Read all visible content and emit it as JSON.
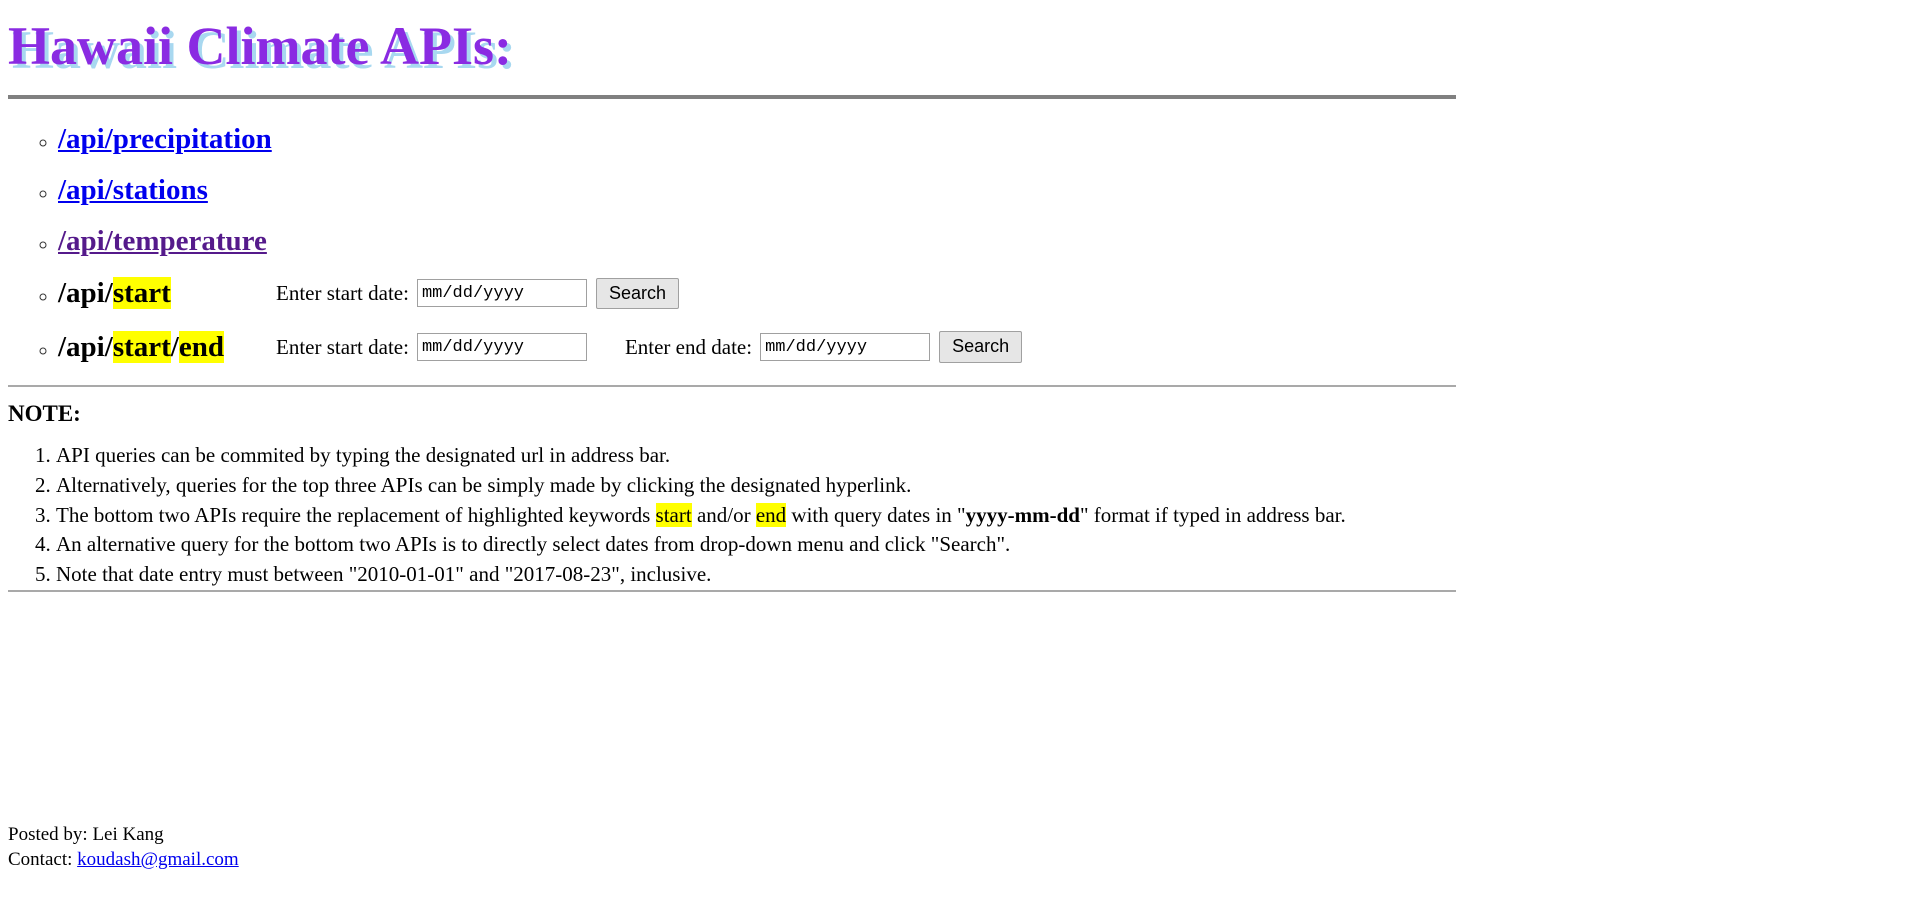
{
  "page": {
    "title": "Hawaii Climate APIs:"
  },
  "api_list": [
    {
      "kind": "link",
      "label": "/api/precipitation",
      "visited": false
    },
    {
      "kind": "link",
      "label": "/api/stations",
      "visited": false
    },
    {
      "kind": "link",
      "label": "/api/temperature",
      "visited": true
    },
    {
      "kind": "form",
      "prefix": "/api/",
      "keyword_start": "start",
      "separator": "",
      "keyword_end": "",
      "start_field": {
        "label": "Enter start date:",
        "placeholder": "mm/dd/yyyy",
        "value": ""
      },
      "search_label": "Search"
    },
    {
      "kind": "form",
      "prefix": "/api/",
      "keyword_start": "start",
      "separator": "/",
      "keyword_end": "end",
      "start_field": {
        "label": "Enter start date:",
        "placeholder": "mm/dd/yyyy",
        "value": ""
      },
      "end_field": {
        "label": "Enter end date:",
        "placeholder": "mm/dd/yyyy",
        "value": ""
      },
      "search_label": "Search"
    }
  ],
  "note": {
    "heading": "NOTE:",
    "items": [
      {
        "parts": [
          {
            "text": "API queries can be commited by typing the designated url in address bar.",
            "style": "plain"
          }
        ]
      },
      {
        "parts": [
          {
            "text": "Alternatively, queries for the top three APIs can be simply made by clicking the designated hyperlink.",
            "style": "plain"
          }
        ]
      },
      {
        "parts": [
          {
            "text": "The bottom two APIs require the replacement of highlighted keywords ",
            "style": "plain"
          },
          {
            "text": "start",
            "style": "highlight"
          },
          {
            "text": " and/or ",
            "style": "plain"
          },
          {
            "text": "end",
            "style": "highlight"
          },
          {
            "text": " with query dates in \"",
            "style": "plain"
          },
          {
            "text": "yyyy-mm-dd",
            "style": "bold"
          },
          {
            "text": "\" format if typed in address bar.",
            "style": "plain"
          }
        ]
      },
      {
        "parts": [
          {
            "text": "An alternative query for the bottom two APIs is to directly select dates from drop-down menu and click \"Search\".",
            "style": "plain"
          }
        ]
      },
      {
        "parts": [
          {
            "text": "Note that date entry must between \"2010-01-01\" and \"2017-08-23\", inclusive.",
            "style": "plain"
          }
        ]
      }
    ]
  },
  "footer": {
    "posted_by_label": "Posted by: ",
    "posted_by_name": "Lei Kang",
    "contact_label": "Contact: ",
    "contact_email": "koudash@gmail.com"
  },
  "colors": {
    "title_text": "#8a2be2",
    "title_shadow": "#a8d8f0",
    "link": "#0000ee",
    "link_visited": "#551a8b",
    "highlight": "#ffff00",
    "rule_thick": "#808080",
    "rule_thin": "#a9a9a9",
    "button_bg": "#e6e6e6"
  }
}
